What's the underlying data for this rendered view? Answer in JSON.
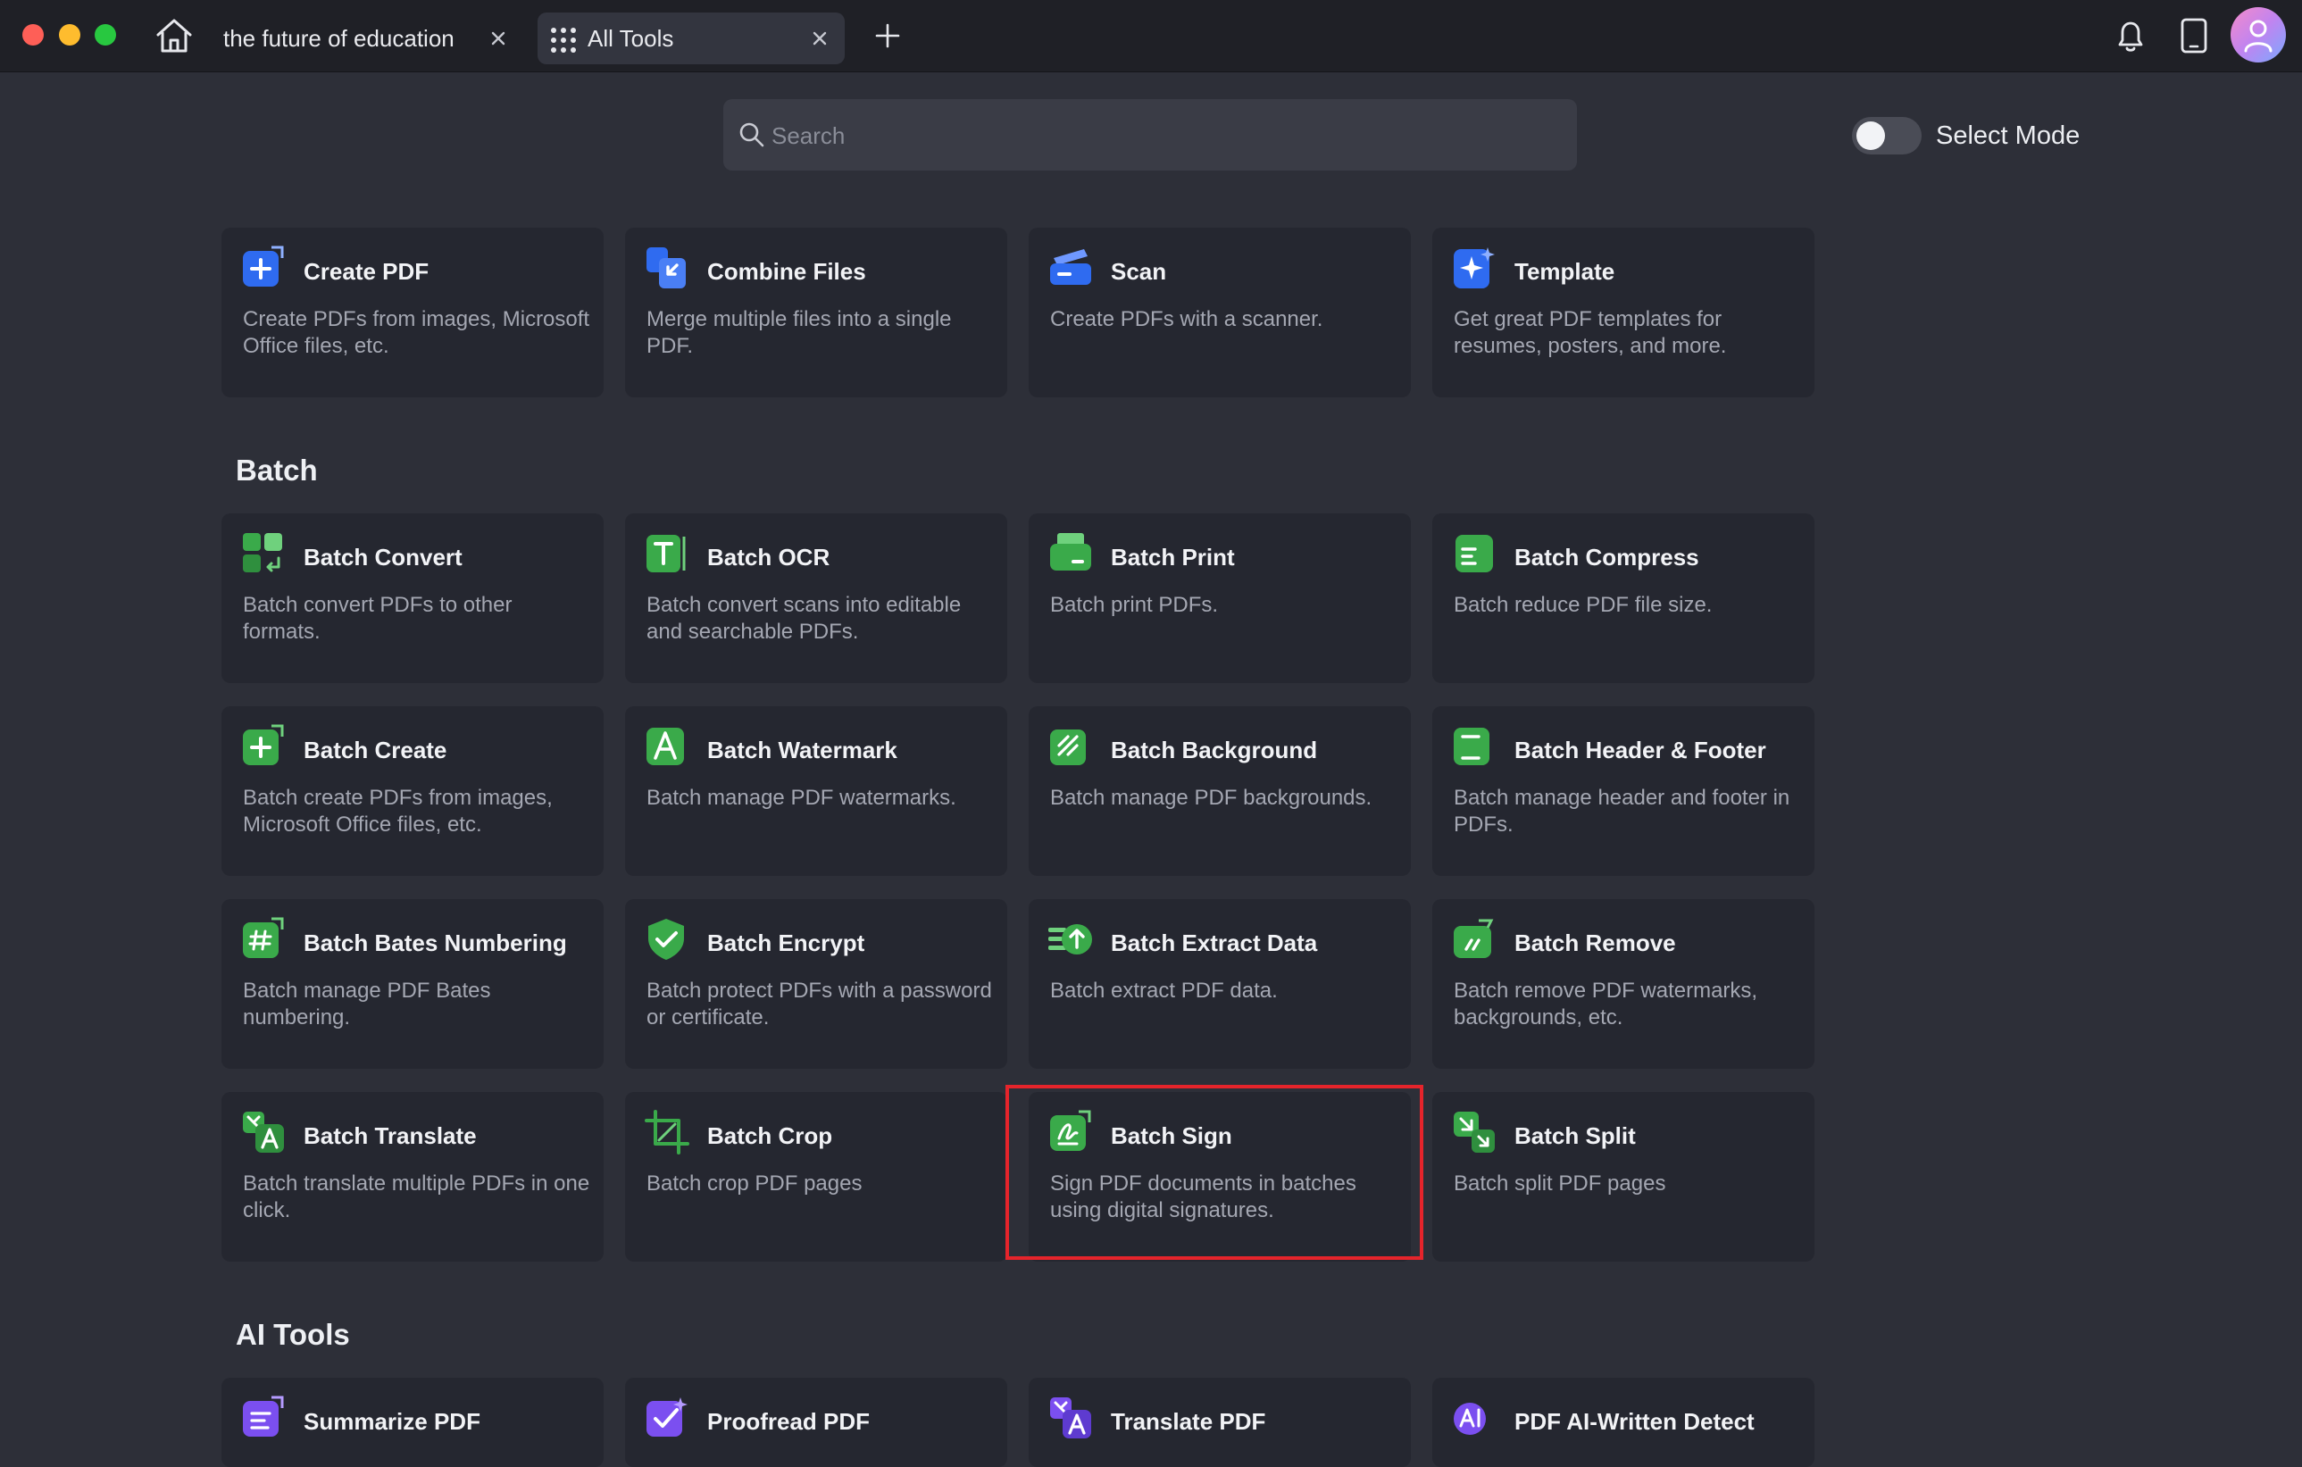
{
  "titlebar": {
    "tabs": [
      {
        "label": "the future of education"
      },
      {
        "label": "All Tools"
      }
    ]
  },
  "search": {
    "placeholder": "Search",
    "value": ""
  },
  "select_mode": {
    "label": "Select Mode",
    "on": false
  },
  "top_row": [
    {
      "name": "create-pdf",
      "title": "Create PDF",
      "desc": "Create PDFs from images, Microsoft Office files, etc.",
      "icon": "create-pdf-icon"
    },
    {
      "name": "combine-files",
      "title": "Combine Files",
      "desc": "Merge multiple files into a single PDF.",
      "icon": "combine-files-icon"
    },
    {
      "name": "scan",
      "title": "Scan",
      "desc": "Create PDFs with a scanner.",
      "icon": "scanner-icon"
    },
    {
      "name": "template",
      "title": "Template",
      "desc": "Get great PDF templates for resumes, posters, and more.",
      "icon": "template-icon"
    }
  ],
  "sections": {
    "batch": "Batch",
    "ai_tools": "AI Tools"
  },
  "batch": [
    {
      "name": "batch-convert",
      "title": "Batch Convert",
      "desc": "Batch convert PDFs to other formats.",
      "icon": "batch-convert-icon"
    },
    {
      "name": "batch-ocr",
      "title": "Batch OCR",
      "desc": "Batch convert scans into editable and searchable PDFs.",
      "icon": "batch-ocr-icon"
    },
    {
      "name": "batch-print",
      "title": "Batch Print",
      "desc": "Batch print PDFs.",
      "icon": "batch-print-icon"
    },
    {
      "name": "batch-compress",
      "title": "Batch Compress",
      "desc": "Batch reduce PDF file size.",
      "icon": "batch-compress-icon"
    },
    {
      "name": "batch-create",
      "title": "Batch Create",
      "desc": "Batch create PDFs from images, Microsoft Office files, etc.",
      "icon": "batch-create-icon"
    },
    {
      "name": "batch-watermark",
      "title": "Batch Watermark",
      "desc": "Batch manage PDF watermarks.",
      "icon": "batch-watermark-icon"
    },
    {
      "name": "batch-background",
      "title": "Batch Background",
      "desc": "Batch manage PDF backgrounds.",
      "icon": "batch-background-icon"
    },
    {
      "name": "batch-header-footer",
      "title": "Batch Header & Footer",
      "desc": "Batch manage header and footer in PDFs.",
      "icon": "batch-header-footer-icon"
    },
    {
      "name": "batch-bates-numbering",
      "title": "Batch Bates Numbering",
      "desc": "Batch manage PDF Bates numbering.",
      "icon": "batch-bates-icon"
    },
    {
      "name": "batch-encrypt",
      "title": "Batch Encrypt",
      "desc": "Batch protect PDFs with a password or certificate.",
      "icon": "batch-encrypt-icon"
    },
    {
      "name": "batch-extract-data",
      "title": "Batch Extract Data",
      "desc": "Batch extract PDF data.",
      "icon": "batch-extract-icon"
    },
    {
      "name": "batch-remove",
      "title": "Batch Remove",
      "desc": "Batch remove PDF watermarks, backgrounds, etc.",
      "icon": "batch-remove-icon"
    },
    {
      "name": "batch-translate",
      "title": "Batch Translate",
      "desc": "Batch translate multiple PDFs in one click.",
      "icon": "batch-translate-icon"
    },
    {
      "name": "batch-crop",
      "title": "Batch Crop",
      "desc": "Batch crop PDF pages",
      "icon": "batch-crop-icon"
    },
    {
      "name": "batch-sign",
      "title": "Batch Sign",
      "desc": "Sign PDF documents in batches using digital signatures.",
      "icon": "batch-sign-icon"
    },
    {
      "name": "batch-split",
      "title": "Batch Split",
      "desc": "Batch split PDF pages",
      "icon": "batch-split-icon"
    }
  ],
  "ai_tools": [
    {
      "name": "summarize-pdf",
      "title": "Summarize PDF",
      "icon": "summarize-pdf-icon"
    },
    {
      "name": "proofread-pdf",
      "title": "Proofread PDF",
      "icon": "proofread-pdf-icon"
    },
    {
      "name": "translate-pdf",
      "title": "Translate PDF",
      "icon": "translate-pdf-icon"
    },
    {
      "name": "pdf-ai-written-detect",
      "title": "PDF AI-Written Detect",
      "icon": "ai-detect-icon"
    }
  ],
  "colors": {
    "blue_icon": "#2f6bf0",
    "green_icon": "#3aaa4a",
    "purple_icon": "#7b4ff0",
    "highlight": "#e5242b"
  }
}
